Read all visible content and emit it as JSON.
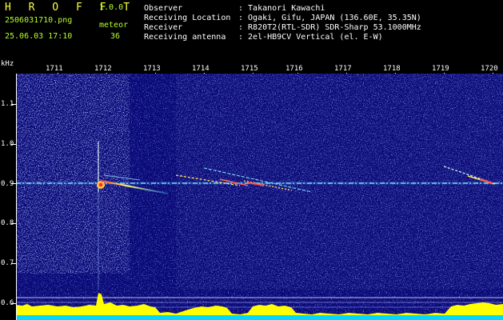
{
  "header": {
    "app_title": "H R O F F T",
    "app_version": "1.0.0",
    "filename": "2506031710.png",
    "datetime": "25.06.03 17:10",
    "event_type": "meteor",
    "event_count": "36",
    "info": [
      {
        "label": "Observer",
        "value": ": Takanori Kawachi"
      },
      {
        "label": "Receiving Location",
        "value": ": Ogaki, Gifu, JAPAN (136.60E, 35.35N)"
      },
      {
        "label": "Receiver",
        "value": ": R820T2(RTL-SDR) SDR-Sharp 53.1000MHz"
      },
      {
        "label": "Receiving antenna",
        "value": ": 2el-HB9CV Vertical (el. E-W)"
      }
    ]
  },
  "spectrogram": {
    "y_unit": "kHz",
    "y_ticks": [
      "1.1",
      "1.0",
      "0.9",
      "0.8",
      "0.7",
      "0.6"
    ],
    "x_ticks": [
      "1711",
      "1712",
      "1713",
      "1714",
      "1715",
      "1716",
      "1717",
      "1718",
      "1719",
      "1720"
    ],
    "colors": {
      "background": "#0a0a6e",
      "noise": "#3a4cff",
      "carrier": "#9fe8ff",
      "meter": "#ffff00",
      "meter_base": "#00d8ff"
    }
  }
}
